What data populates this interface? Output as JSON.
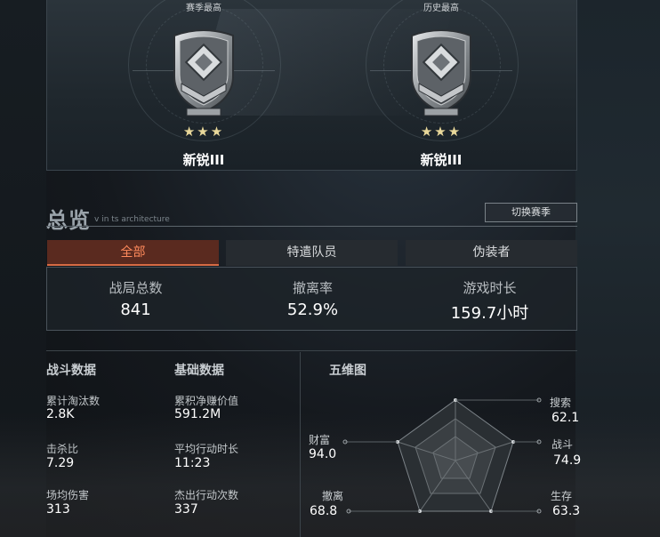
{
  "ranks": [
    {
      "caption": "赛季最高",
      "stars": "★★★",
      "name": "新锐III"
    },
    {
      "caption": "历史最高",
      "stars": "★★★",
      "name": "新锐III"
    }
  ],
  "overview": {
    "title": "总览",
    "subtitle": "v in ts architecture",
    "switch_label": "切换赛季"
  },
  "tabs": [
    "全部",
    "特遣队员",
    "伪装者"
  ],
  "summary": [
    {
      "label": "战局总数",
      "value": "841"
    },
    {
      "label": "撤离率",
      "value": "52.9%"
    },
    {
      "label": "游戏时长",
      "value": "159.7小时"
    }
  ],
  "combat": {
    "title": "战斗数据",
    "items": [
      {
        "label": "累计淘汰数",
        "value": "2.8K"
      },
      {
        "label": "击杀比",
        "value": "7.29"
      },
      {
        "label": "场均伤害",
        "value": "313"
      }
    ]
  },
  "basic": {
    "title": "基础数据",
    "items": [
      {
        "label": "累积净赚价值",
        "value": "591.2M"
      },
      {
        "label": "平均行动时长",
        "value": "11:23"
      },
      {
        "label": "杰出行动次数",
        "value": "337"
      }
    ]
  },
  "radar": {
    "title": "五维图",
    "axes": [
      {
        "label": "搜索",
        "value": "62.1"
      },
      {
        "label": "战斗",
        "value": "74.9"
      },
      {
        "label": "生存",
        "value": "63.3"
      },
      {
        "label": "撤离",
        "value": "68.8"
      },
      {
        "label": "财富",
        "value": "94.0"
      }
    ]
  },
  "colors": {
    "accent": "#ff8a5c",
    "tab_active_bg": "#5a2a1f"
  }
}
